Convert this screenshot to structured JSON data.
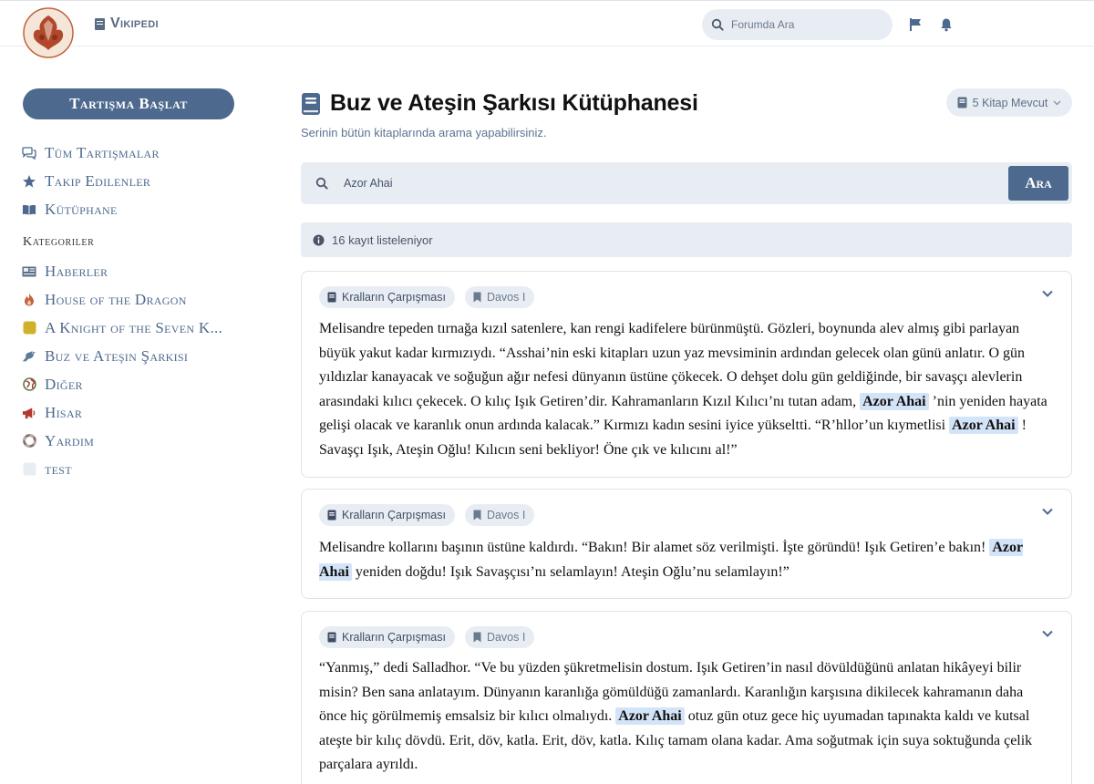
{
  "header": {
    "wiki_label": "Vikipedi",
    "search_placeholder": "Forumda Ara"
  },
  "sidebar": {
    "start_button": "Tartışma Başlat",
    "nav": [
      {
        "label": "Tüm Tartışmalar",
        "icon": "comments-icon"
      },
      {
        "label": "Takip Edilenler",
        "icon": "star-icon"
      },
      {
        "label": "Kütüphane",
        "icon": "book-open-icon"
      }
    ],
    "categories_title": "Kategoriler",
    "categories": [
      {
        "label": "Haberler",
        "icon": "newspaper-icon",
        "color": "#5d6f88"
      },
      {
        "label": "House of the Dragon",
        "icon": "flame-icon",
        "color": "#c0643c"
      },
      {
        "label": "A Knight of the Seven K...",
        "icon": "square-icon",
        "color": "#d1b12a"
      },
      {
        "label": "Buz ve Ateşin Şarkısı",
        "icon": "raven-icon",
        "color": "#5d7a9a"
      },
      {
        "label": "Diğer",
        "icon": "globe-icon",
        "color": "#5a7a4a"
      },
      {
        "label": "Hisar",
        "icon": "bullhorn-icon",
        "color": "#b03a32"
      },
      {
        "label": "Yardım",
        "icon": "lifering-icon",
        "color": "#777777"
      },
      {
        "label": "test",
        "icon": "blank-square-icon",
        "color": "#e8edf3"
      }
    ]
  },
  "main": {
    "title": "Buz ve Ateşin Şarkısı Kütüphanesi",
    "subtitle": "Serinin bütün kitaplarında arama yapabilirsiniz.",
    "books_button": "5 Kitap Mevcut",
    "search_value": "Azor Ahai",
    "search_button": "Ara",
    "results_info": "16 kayıt listeleniyor",
    "highlight_term": "Azor Ahai",
    "results": [
      {
        "book": "Kralların Çarpışması",
        "chapter": "Davos I",
        "text_parts": [
          "Melisandre tepeden tırnağa kızıl satenlere, kan rengi kadifelere bürünmüştü. Gözleri, boynunda alev almış gibi parlayan büyük yakut kadar kırmızıydı. “Asshai’nin eski kitapları uzun yaz mevsiminin ardından gelecek olan günü anlatır. O gün yıldızlar kanayacak ve soğuğun ağır nefesi dünyanın üstüne çökecek. O dehşet dolu gün geldiğinde, bir savaşçı alevlerin arasındaki kılıcı çekecek. O kılıç Işık Getiren’dir. Kahramanların Kızıl Kılıcı’nı tutan adam, ",
          "Azor Ahai",
          " ’nin yeniden hayata gelişi olacak ve karanlık onun ardında kalacak.” Kırmızı kadın sesini iyice yükseltti. “R’hllor’un kıymetlisi ",
          "Azor Ahai",
          " ! Savaşçı Işık, Ateşin Oğlu! Kılıcın seni bekliyor! Öne çık ve kılıcını al!”"
        ]
      },
      {
        "book": "Kralların Çarpışması",
        "chapter": "Davos I",
        "text_parts": [
          "Melisandre kollarını başının üstüne kaldırdı. “Bakın! Bir alamet söz verilmişti. İşte göründü! Işık Getiren’e bakın! ",
          "Azor Ahai",
          " yeniden doğdu! Işık Savaşçısı’nı selamlayın! Ateşin Oğlu’nu selamlayın!”"
        ]
      },
      {
        "book": "Kralların Çarpışması",
        "chapter": "Davos I",
        "text_parts": [
          "“Yanmış,” dedi Salladhor. “Ve bu yüzden şükretmelisin dostum. Işık Getiren’in nasıl dövüldüğünü anlatan hikâyeyi bilir misin? Ben sana anlatayım. Dünyanın karanlığa gömüldüğü zamanlardı. Karanlığın karşısına dikilecek kahramanın daha önce hiç görülmemiş emsalsiz bir kılıcı olmalıydı. ",
          "Azor Ahai",
          " otuz gün otuz gece hiç uyumadan tapınakta kaldı ve kutsal ateşte bir kılıç dövdü. Erit, döv, katla. Erit, döv, katla. Kılıç tamam olana kadar. Ama soğutmak için suya soktuğunda çelik parçalara ayrıldı."
        ]
      }
    ]
  },
  "colors": {
    "accent": "#4d6a8e",
    "panel": "#e8edf3",
    "highlight": "#d4e4f8"
  }
}
